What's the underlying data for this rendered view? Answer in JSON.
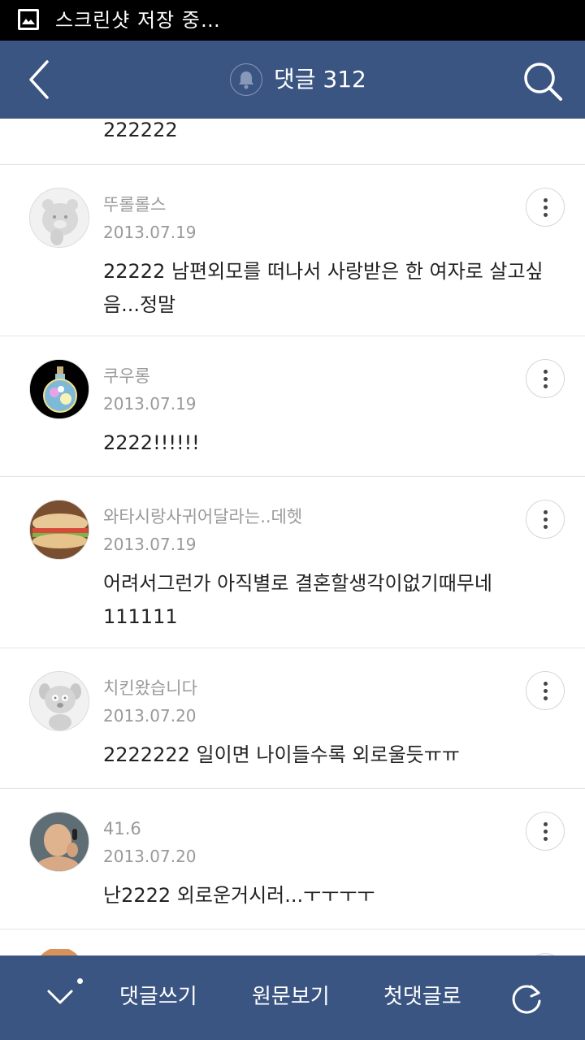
{
  "status_bar": {
    "text": "스크린샷 저장 중…",
    "icon": "image-icon"
  },
  "header": {
    "title": "댓글 312",
    "back_icon": "back-chevron-icon",
    "bell_icon": "bell-icon",
    "search_icon": "search-icon"
  },
  "prev_comment": {
    "text": "222222"
  },
  "comments": [
    {
      "author": "뚜롤롤스",
      "date": "2013.07.19",
      "text": "22222 남편외모를 떠나서 사랑받은 한 여자로 살고싶음...정말",
      "avatar": "bear-avatar"
    },
    {
      "author": "쿠우롱",
      "date": "2013.07.19",
      "text": "2222!!!!!!",
      "avatar": "potion-bottle-avatar"
    },
    {
      "author": "와타시랑사귀어달라는..데헷",
      "date": "2013.07.19",
      "text": "어려서그런가 아직별로 결혼할생각이없기때무네 111111",
      "avatar": "sandwich-avatar"
    },
    {
      "author": "치킨왔습니다",
      "date": "2013.07.20",
      "text": "2222222 일이면 나이들수록 외로울듯ㅠㅠ",
      "avatar": "dog-avatar"
    },
    {
      "author": "41.6",
      "date": "2013.07.20",
      "text": "난2222 외로운거시러...ㅜㅜㅜㅜ",
      "avatar": "person-photo-avatar"
    }
  ],
  "bottom_bar": {
    "write_comment": "댓글쓰기",
    "view_original": "원문보기",
    "first_comment": "첫댓글로",
    "chevron_icon": "chevron-down-icon",
    "refresh_icon": "refresh-icon"
  },
  "colors": {
    "header_bg": "#3b5583",
    "status_bg": "#000000",
    "meta_text": "#9a9a9a",
    "body_text": "#222222"
  }
}
